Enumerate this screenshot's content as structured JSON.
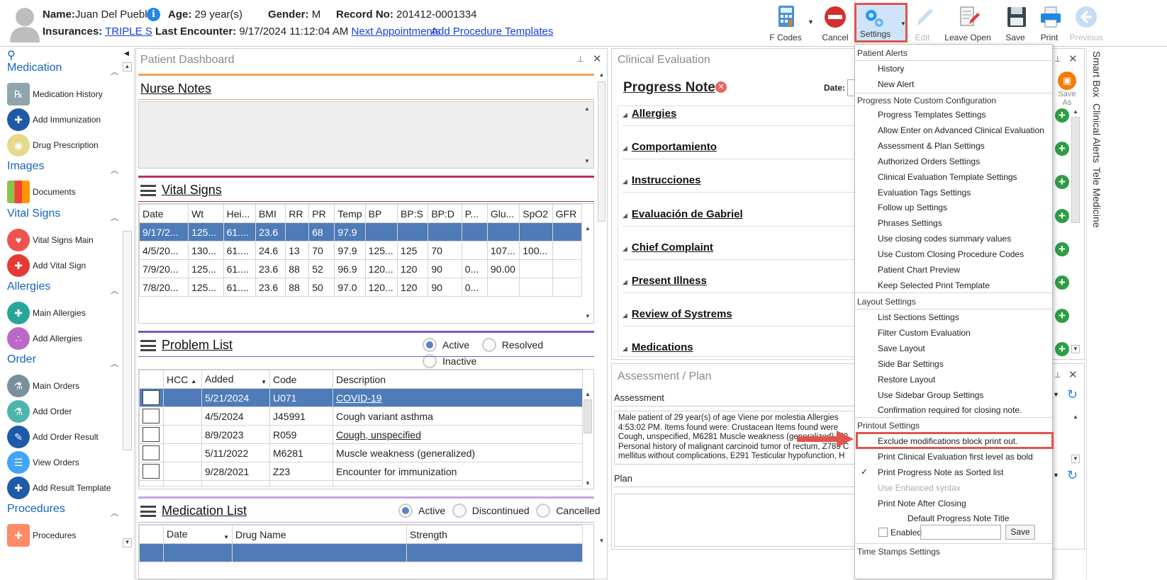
{
  "patient": {
    "name_label": "Name:",
    "name": "Juan Del Pueblo",
    "age_label": "Age:",
    "age": "29 year(s)",
    "gender_label": "Gender:",
    "gender": "M",
    "record_label": "Record No:",
    "record": "201412-0001334",
    "insurances_label": "Insurances:",
    "insurance": "TRIPLE S",
    "last_encounter_label": "Last Encounter:",
    "last_encounter": "9/17/2024 11:12:04 AM",
    "next_appointments": "Next Appointments",
    "add_procedure_templates": "Add Procedure Templates"
  },
  "toolbar": {
    "fcodes": "F Codes",
    "cancel": "Cancel",
    "settings": "Settings",
    "edit": "Edit",
    "leave_open": "Leave Open",
    "save": "Save",
    "print": "Print",
    "previous": "Previous"
  },
  "sidebar": {
    "groups": [
      {
        "title": "Medication",
        "items": [
          "Medication History",
          "Add Immunization",
          "Drug Prescription"
        ]
      },
      {
        "title": "Images",
        "items": [
          "Documents"
        ]
      },
      {
        "title": "Vital Signs",
        "items": [
          "Vital Signs Main",
          "Add Vital Sign"
        ]
      },
      {
        "title": "Allergies",
        "items": [
          "Main Allergies",
          "Add Allergies"
        ]
      },
      {
        "title": "Order",
        "items": [
          "Main Orders",
          "Add Order",
          "Add Order Result",
          "View Orders",
          "Add Result Template"
        ]
      },
      {
        "title": "Procedures",
        "items": [
          "Procedures"
        ]
      }
    ]
  },
  "dashboard": {
    "title": "Patient Dashboard",
    "nurse_notes": "Nurse Notes",
    "vital_signs": "Vital Signs",
    "vital_headers": [
      "Date",
      "Wt",
      "Hei...",
      "BMI",
      "RR",
      "PR",
      "Temp",
      "BP",
      "BP:S",
      "BP:D",
      "P...",
      "Glu...",
      "SpO2",
      "GFR"
    ],
    "vital_rows": [
      [
        "9/17/2...",
        "125...",
        "61....",
        "23.6",
        "",
        "68",
        "97.9",
        "",
        "",
        "",
        "",
        "",
        "",
        ""
      ],
      [
        "4/5/20...",
        "130...",
        "61....",
        "24.6",
        "13",
        "70",
        "97.9",
        "125...",
        "125",
        "70",
        "",
        "107...",
        "100...",
        ""
      ],
      [
        "7/9/20...",
        "125...",
        "61....",
        "23.6",
        "88",
        "52",
        "96.9",
        "120...",
        "120",
        "90",
        "0...",
        "90.00",
        "",
        ""
      ],
      [
        "7/8/20...",
        "125...",
        "61....",
        "23.6",
        "88",
        "50",
        "97.0",
        "120...",
        "120",
        "90",
        "0...",
        "",
        "",
        ""
      ]
    ],
    "problem_list": "Problem List",
    "problem_filters": [
      "Active",
      "Resolved",
      "Inactive"
    ],
    "problem_headers": [
      "HCC",
      "Added",
      "Code",
      "Description"
    ],
    "problem_rows": [
      {
        "added": "5/21/2024",
        "code": "U071",
        "desc": "COVID-19"
      },
      {
        "added": "4/5/2024",
        "code": "J45991",
        "desc": "Cough variant asthma"
      },
      {
        "added": "8/9/2023",
        "code": "R059",
        "desc": "Cough, unspecified"
      },
      {
        "added": "5/11/2022",
        "code": "M6281",
        "desc": "Muscle weakness (generalized)"
      },
      {
        "added": "9/28/2021",
        "code": "Z23",
        "desc": "Encounter for immunization"
      }
    ],
    "medication_list": "Medication List",
    "medication_filters": [
      "Active",
      "Discontinued",
      "Cancelled"
    ],
    "medication_headers": [
      "Date",
      "Drug Name",
      "Strength"
    ]
  },
  "clinical": {
    "title": "Clinical Evaluation",
    "progress_note": "Progress Note",
    "date_label": "Date:",
    "save_as": "Save As",
    "sections": [
      "Allergies",
      "Comportamiento",
      "Instrucciones",
      "Evaluación de Gabriel",
      "Chief Complaint",
      "Present Illness",
      "Review of Systrems",
      "Medications"
    ]
  },
  "assessment": {
    "title": "Assessment / Plan",
    "assessment_label": "Assessment",
    "text_lines": [
      "Male patient of 29 year(s) of age Viene por molestia    Allergies",
      "4:53:02 PM.   Items found were:  Crustacean  Items found were",
      "Cough, unspecified, M6281 Muscle weakness (generalized), Z2",
      "Personal history of malignant carcinoid tumor of rectum, Z789 C",
      "mellitus without complications, E291 Testicular hypofunction, H"
    ],
    "plan_label": "Plan"
  },
  "side_tabs": [
    "Smart Box",
    "Clinical Alerts",
    "Tele Medicine"
  ],
  "settings_menu": {
    "patient_alerts": "Patient Alerts",
    "alerts_items": [
      "History",
      "New Alert"
    ],
    "progress_config": "Progress Note Custom Configuration",
    "progress_items": [
      "Progress Templates Settings",
      "Allow Enter on Advanced Clinical Evaluation",
      "Assessment & Plan Settings",
      "Authorized Orders Settings",
      "Clinical Evaluation Template Settings",
      "Evaluation Tags Settings",
      "Follow up Settings",
      "Phrases Settings",
      "Use closing codes summary values",
      "Use Custom Closing Procedure Codes",
      "Patient Chart Preview",
      "Keep Selected Print Template"
    ],
    "layout_settings": "Layout Settings",
    "layout_items": [
      "List Sections Settings",
      "Filter Custom Evaluation",
      "Save Layout",
      "Side Bar Settings",
      "Restore Layout",
      "Use Sidebar Group Settings",
      "Confirmation required for closing note."
    ],
    "printout_settings": "Printout Settings",
    "printout_items": [
      "Exclude modifications block print out.",
      "Print Clinical Evaluation first level as bold",
      "Print Progress Note as Sorted list",
      "Use Enhanced syntax",
      "Print Note After Closing"
    ],
    "default_title": "Default Progress Note Title",
    "enabled": "Enabled",
    "save": "Save",
    "time_stamps": "Time Stamps Settings"
  },
  "colors": {
    "accent": "#1565c0",
    "selected_row": "#4f7cb8",
    "highlight": "#e0554a",
    "add_green": "#2e9e44"
  }
}
